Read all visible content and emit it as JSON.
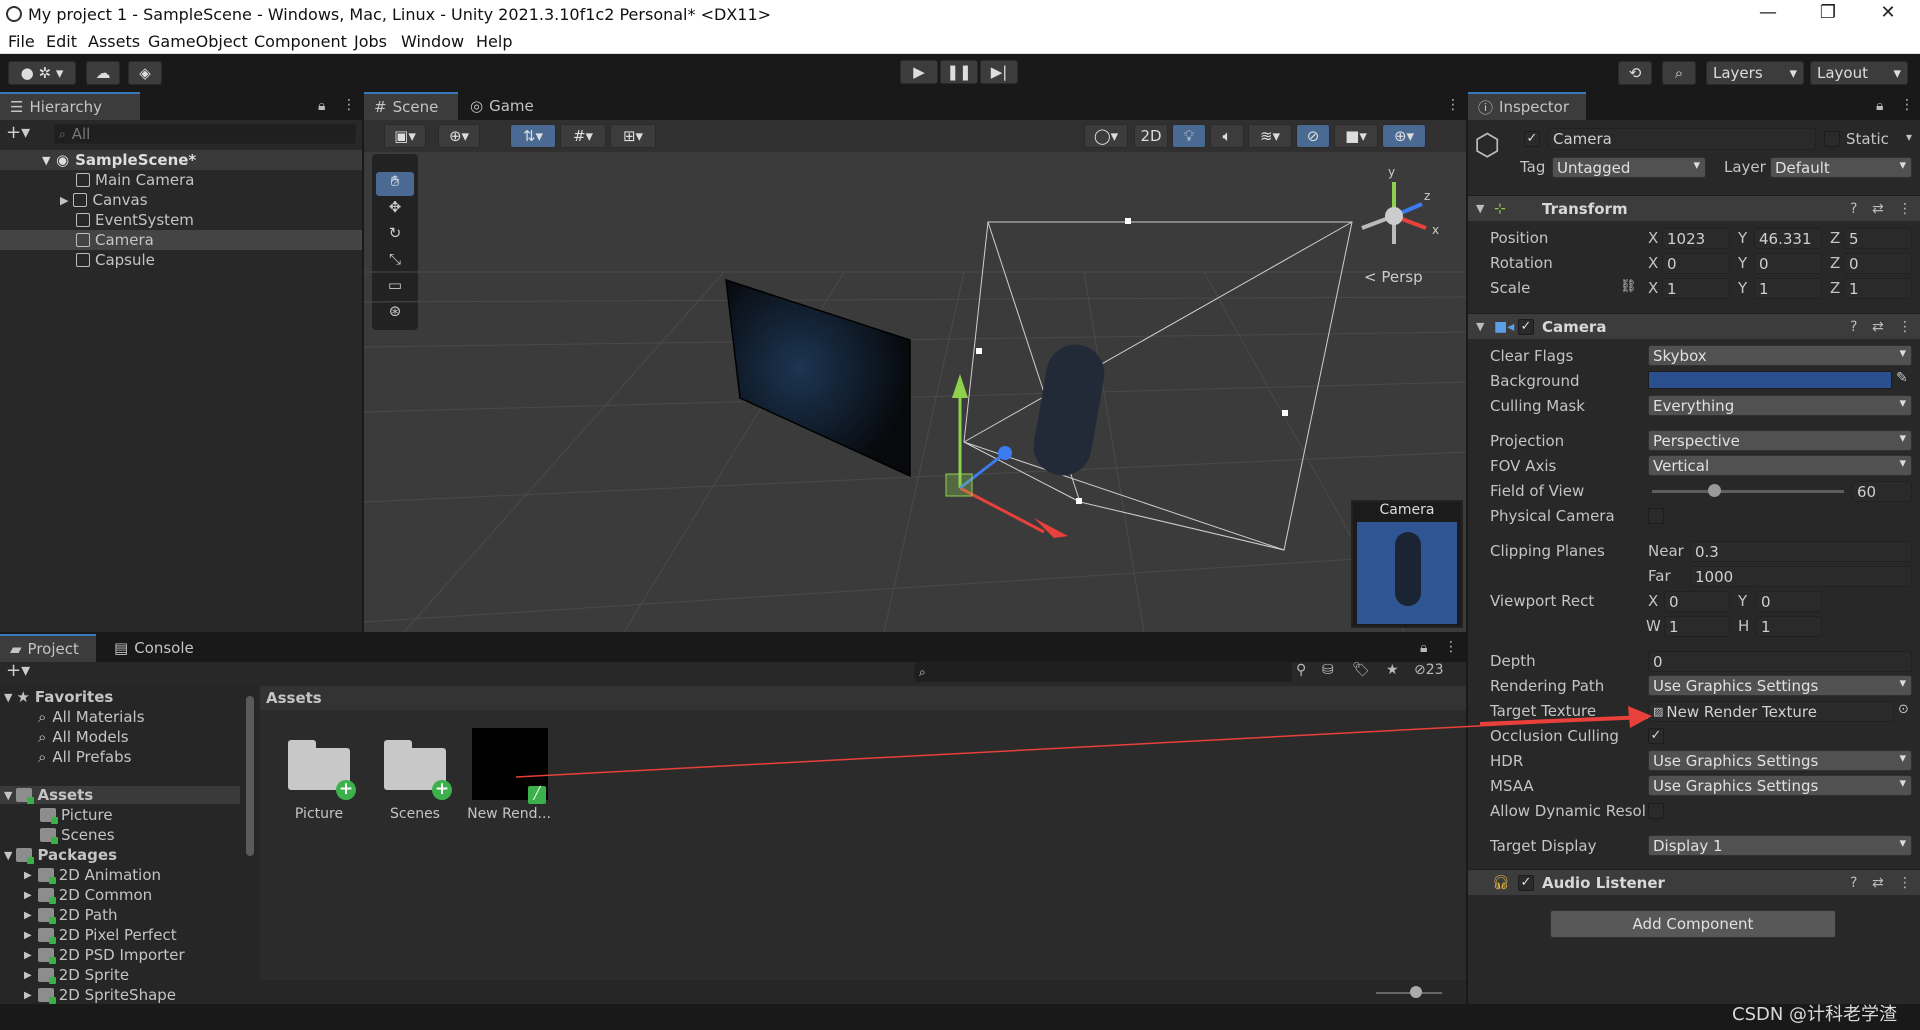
{
  "window": {
    "title": "My project  1 - SampleScene - Windows, Mac, Linux - Unity 2021.3.10f1c2 Personal* <DX11>",
    "controls": [
      "—",
      "❐",
      "✕"
    ]
  },
  "menu": [
    "File",
    "Edit",
    "Assets",
    "GameObject",
    "Component",
    "Jobs",
    "Window",
    "Help"
  ],
  "toolbar": {
    "layers_label": "Layers",
    "layout_label": "Layout"
  },
  "hierarchy": {
    "tab": "Hierarchy",
    "search_placeholder": "All",
    "scene": "SampleScene*",
    "items": [
      "Main Camera",
      "Canvas",
      "EventSystem",
      "Camera",
      "Capsule"
    ]
  },
  "scene_view": {
    "tabs": [
      "Scene",
      "Game"
    ],
    "mode_2d": "2D",
    "persp_label": "Persp",
    "gizmo_labels": {
      "y": "y",
      "z": "z",
      "x": "x"
    },
    "preview_title": "Camera"
  },
  "inspector": {
    "tab": "Inspector",
    "object_name": "Camera",
    "static_label": "Static",
    "tag_label": "Tag",
    "tag_value": "Untagged",
    "layer_label": "Layer",
    "layer_value": "Default",
    "transform": {
      "title": "Transform",
      "position": {
        "label": "Position",
        "x": "1023",
        "y": "46.331",
        "z": "5"
      },
      "rotation": {
        "label": "Rotation",
        "x": "0",
        "y": "0",
        "z": "0"
      },
      "scale": {
        "label": "Scale",
        "x": "1",
        "y": "1",
        "z": "1"
      }
    },
    "camera": {
      "title": "Camera",
      "clear_flags": {
        "label": "Clear Flags",
        "value": "Skybox"
      },
      "background": {
        "label": "Background",
        "color": "#2a4f8f"
      },
      "culling_mask": {
        "label": "Culling Mask",
        "value": "Everything"
      },
      "projection": {
        "label": "Projection",
        "value": "Perspective"
      },
      "fov_axis": {
        "label": "FOV Axis",
        "value": "Vertical"
      },
      "field_of_view": {
        "label": "Field of View",
        "value": "60"
      },
      "physical_camera": {
        "label": "Physical Camera"
      },
      "clipping_planes": {
        "label": "Clipping Planes",
        "near_label": "Near",
        "near": "0.3",
        "far_label": "Far",
        "far": "1000"
      },
      "viewport_rect": {
        "label": "Viewport Rect",
        "x": "0",
        "y": "0",
        "w": "1",
        "h": "1"
      },
      "depth": {
        "label": "Depth",
        "value": "0"
      },
      "rendering_path": {
        "label": "Rendering Path",
        "value": "Use Graphics Settings"
      },
      "target_texture": {
        "label": "Target Texture",
        "value": "New Render Texture"
      },
      "occlusion_culling": {
        "label": "Occlusion Culling"
      },
      "hdr": {
        "label": "HDR",
        "value": "Use Graphics Settings"
      },
      "msaa": {
        "label": "MSAA",
        "value": "Use Graphics Settings"
      },
      "allow_dynamic": {
        "label": "Allow Dynamic Resol"
      },
      "target_display": {
        "label": "Target Display",
        "value": "Display 1"
      }
    },
    "audio_listener": {
      "title": "Audio Listener"
    },
    "add_component": "Add Component"
  },
  "project": {
    "tabs": [
      "Project",
      "Console"
    ],
    "hidden_count": "23",
    "favorites_title": "Favorites",
    "favorites": [
      "All Materials",
      "All Models",
      "All Prefabs"
    ],
    "assets_title": "Assets",
    "assets_folders": [
      "Picture",
      "Scenes"
    ],
    "packages_title": "Packages",
    "packages": [
      "2D Animation",
      "2D Common",
      "2D Path",
      "2D Pixel Perfect",
      "2D PSD Importer",
      "2D Sprite",
      "2D SpriteShape"
    ],
    "breadcrumb": "Assets",
    "grid_items": [
      "Picture",
      "Scenes",
      "New Rend..."
    ]
  },
  "watermark": "CSDN @计科老学渣",
  "colors": {
    "accent": "#3a79bb",
    "arrow_red": "#e8403a",
    "panel": "#282828",
    "dark": "#191919"
  }
}
